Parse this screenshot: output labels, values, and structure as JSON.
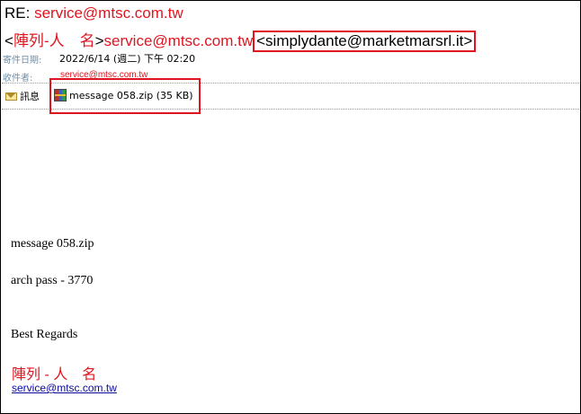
{
  "header": {
    "subject_prefix": "RE:",
    "subject_email": "service@mtsc.com.tw",
    "from_display_open": "<",
    "from_display_name": "陣列-人　名",
    "from_display_close": ">",
    "from_display_email": "service@mtsc.com.tw",
    "from_sender": "<simplydante@marketmarsrl.it>",
    "sent_label": "寄件日期:",
    "sent_value": "2022/6/14 (週二) 下午 02:20",
    "to_label": "收件者:",
    "to_value": "service@mtsc.com.tw"
  },
  "attachments": {
    "message_tab_label": "訊息",
    "file_label": "message 058.zip (35 KB)"
  },
  "body": {
    "line1": "message 058.zip",
    "line2": "arch pass - 3770",
    "line3": "Best Regards",
    "signature_name": "陣列 - 人　名",
    "signature_email": "service@mtsc.com.tw"
  },
  "colors": {
    "highlight_red": "#e0141e",
    "link_blue": "#0a0aa0",
    "label_gray_blue": "#7090a8"
  },
  "icons": {
    "message_tab_icon": "envelope-icon",
    "attachment_icon": "zip-archive-icon"
  }
}
